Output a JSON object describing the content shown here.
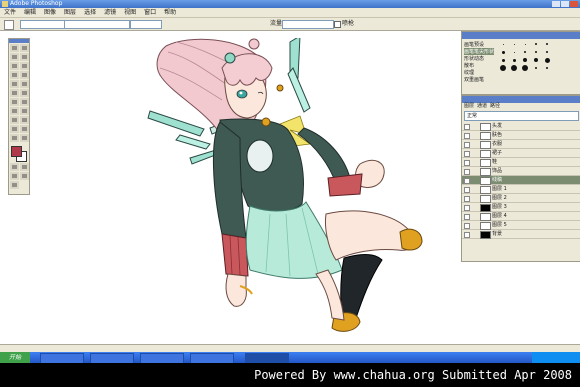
{
  "app": {
    "title": "Adobe Photoshop"
  },
  "menu": [
    "文件",
    "编辑",
    "图像",
    "图层",
    "选择",
    "滤镜",
    "视图",
    "窗口",
    "帮助"
  ],
  "options_bar": {
    "field_1": "",
    "label_1": "流量",
    "field_2": "",
    "label_2": "喷枪"
  },
  "brush_panel": {
    "tabs": [
      "画笔预设",
      "画笔笔尖形状",
      "形状动态",
      "散布",
      "纹理",
      "双重画笔"
    ],
    "brush_sizes": [
      "1",
      "3",
      "5",
      "9",
      "13",
      "19",
      "5",
      "9",
      "13",
      "17",
      "21",
      "27",
      "35",
      "45",
      "65",
      "100",
      "200",
      "300",
      "9",
      "13",
      "19",
      "17",
      "45",
      "65"
    ]
  },
  "layers_panel": {
    "tabs": [
      "图层",
      "通道",
      "路径"
    ],
    "blend_mode": "正常",
    "layers": [
      {
        "name": "头发",
        "selected": false,
        "black": false
      },
      {
        "name": "肤色",
        "selected": false,
        "black": false
      },
      {
        "name": "衣服",
        "selected": false,
        "black": false
      },
      {
        "name": "裙子",
        "selected": false,
        "black": false
      },
      {
        "name": "鞋",
        "selected": false,
        "black": false
      },
      {
        "name": "饰品",
        "selected": false,
        "black": false
      },
      {
        "name": "线稿",
        "selected": true,
        "black": false
      },
      {
        "name": "图层 1",
        "selected": false,
        "black": false
      },
      {
        "name": "图层 2",
        "selected": false,
        "black": false
      },
      {
        "name": "图层 3",
        "selected": false,
        "black": true
      },
      {
        "name": "图层 4",
        "selected": false,
        "black": false
      },
      {
        "name": "图层 5",
        "selected": false,
        "black": false
      },
      {
        "name": "背景",
        "selected": false,
        "black": true
      }
    ]
  },
  "status": {
    "zoom": ""
  },
  "taskbar": {
    "start": "开始",
    "tasks": [
      "",
      "",
      "",
      "",
      ""
    ],
    "clock": ""
  },
  "footer": {
    "credit": "Powered By www.chahua.org  Submitted Apr 2008"
  },
  "colors": {
    "foreground": "#b03848",
    "hair": "#f2c9cf",
    "jacket": "#3f5a52",
    "skirt": "#b7ead9",
    "accent": "#e0a020"
  }
}
